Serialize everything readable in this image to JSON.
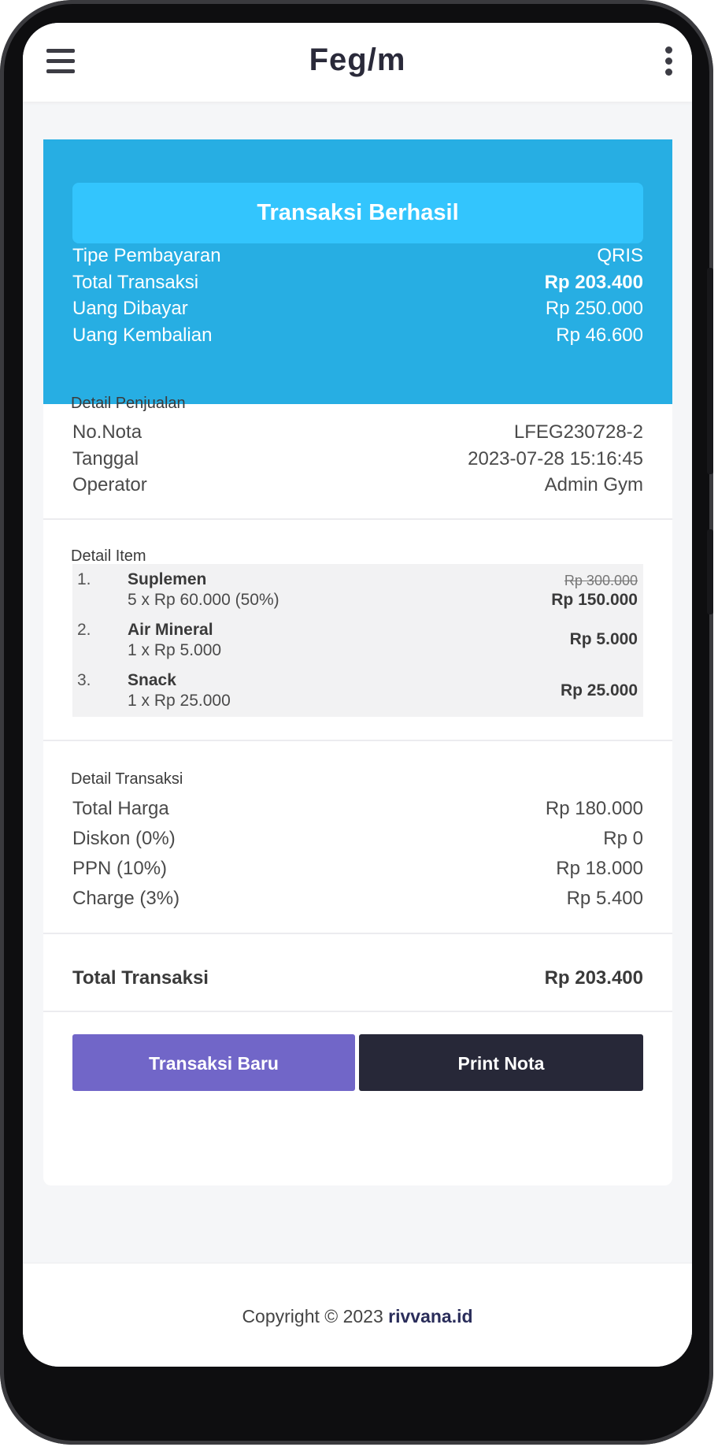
{
  "app": {
    "logo": "Feg/m"
  },
  "hero": {
    "banner": "Transaksi Berhasil",
    "rows": [
      {
        "label": "Tipe Pembayaran",
        "value": "QRIS"
      },
      {
        "label": "Total Transaksi",
        "value": "Rp 203.400"
      },
      {
        "label": "Uang Dibayar",
        "value": "Rp 250.000"
      },
      {
        "label": "Uang Kembalian",
        "value": "Rp 46.600"
      }
    ]
  },
  "sales": {
    "title": "Detail Penjualan",
    "rows": [
      {
        "label": "No.Nota",
        "value": "LFEG230728-2"
      },
      {
        "label": "Tanggal",
        "value": "2023-07-28 15:16:45"
      },
      {
        "label": "Operator",
        "value": "Admin Gym"
      }
    ]
  },
  "items": {
    "title": "Detail Item",
    "list": [
      {
        "num": "1.",
        "name": "Suplemen",
        "qty": "5 x Rp 60.000 (50%)",
        "old_price": "Rp 300.000",
        "price": "Rp 150.000"
      },
      {
        "num": "2.",
        "name": "Air Mineral",
        "qty": "1 x Rp 5.000",
        "price": "Rp 5.000"
      },
      {
        "num": "3.",
        "name": "Snack",
        "qty": "1 x Rp 25.000",
        "price": "Rp 25.000"
      }
    ]
  },
  "transaction": {
    "title": "Detail Transaksi",
    "rows": [
      {
        "label": "Total Harga",
        "value": "Rp 180.000"
      },
      {
        "label": "Diskon (0%)",
        "value": "Rp 0"
      },
      {
        "label": "PPN (10%)",
        "value": "Rp 18.000"
      },
      {
        "label": "Charge (3%)",
        "value": "Rp 5.400"
      }
    ],
    "total_label": "Total Transaksi",
    "total_value": "Rp 203.400"
  },
  "actions": {
    "new_label": "Transaksi Baru",
    "print_label": "Print Nota"
  },
  "footer": {
    "copyright": "Copyright © 2023",
    "link": "rivvana.id"
  },
  "colors": {
    "hero": "#27aee3",
    "banner": "#33c5fd",
    "btn_new": "#7166c8",
    "btn_print": "#272838"
  }
}
